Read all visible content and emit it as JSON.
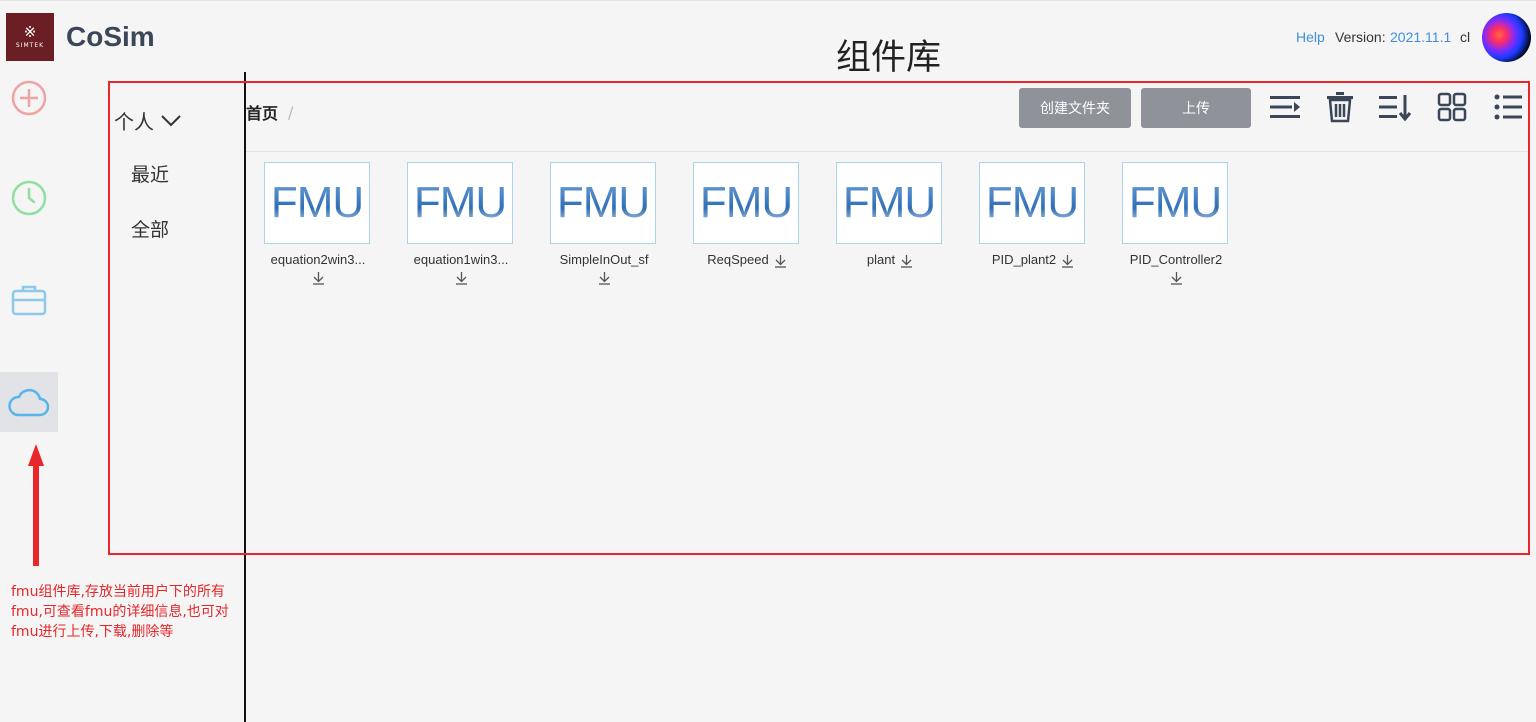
{
  "header": {
    "logo_glyph": "※",
    "logo_text": "SIMTEK",
    "app_title": "CoSim",
    "page_title": "组件库",
    "help_label": "Help",
    "version_label": "Version:",
    "version_value": "2021.11.1",
    "user_label": "cl"
  },
  "rail": {
    "items": [
      {
        "icon": "plus-circle-icon",
        "color": "#f0a3a3"
      },
      {
        "icon": "clock-icon",
        "color": "#8fe0a0"
      },
      {
        "icon": "briefcase-icon",
        "color": "#8ec8ec"
      },
      {
        "icon": "cloud-icon",
        "color": "#58b4ec",
        "active": true
      }
    ]
  },
  "folders": {
    "toggle_label": "个人",
    "items": [
      {
        "label": "最近"
      },
      {
        "label": "全部"
      }
    ]
  },
  "breadcrumb": {
    "items": [
      {
        "label": "首页"
      }
    ],
    "separator": "/"
  },
  "toolbar": {
    "create_folder_label": "创建文件夹",
    "upload_label": "上传",
    "icons": [
      "collapse-menu-icon",
      "trash-icon",
      "sort-icon",
      "grid-view-icon",
      "list-view-icon"
    ]
  },
  "files": [
    {
      "thumb_label": "FMU",
      "name": "equation2win3...",
      "download_inline": false
    },
    {
      "thumb_label": "FMU",
      "name": "equation1win3...",
      "download_inline": false
    },
    {
      "thumb_label": "FMU",
      "name": "SimpleInOut_sf",
      "download_inline": false
    },
    {
      "thumb_label": "FMU",
      "name": "ReqSpeed",
      "download_inline": true
    },
    {
      "thumb_label": "FMU",
      "name": "plant",
      "download_inline": true
    },
    {
      "thumb_label": "FMU",
      "name": "PID_plant2",
      "download_inline": true
    },
    {
      "thumb_label": "FMU",
      "name": "PID_Controller2",
      "download_inline": false
    }
  ],
  "annotation": {
    "text": "fmu组件库,存放当前用户下的所有fmu,可查看fmu的详细信息,也可对fmu进行上传,下载,删除等",
    "color": "#e8272a"
  }
}
